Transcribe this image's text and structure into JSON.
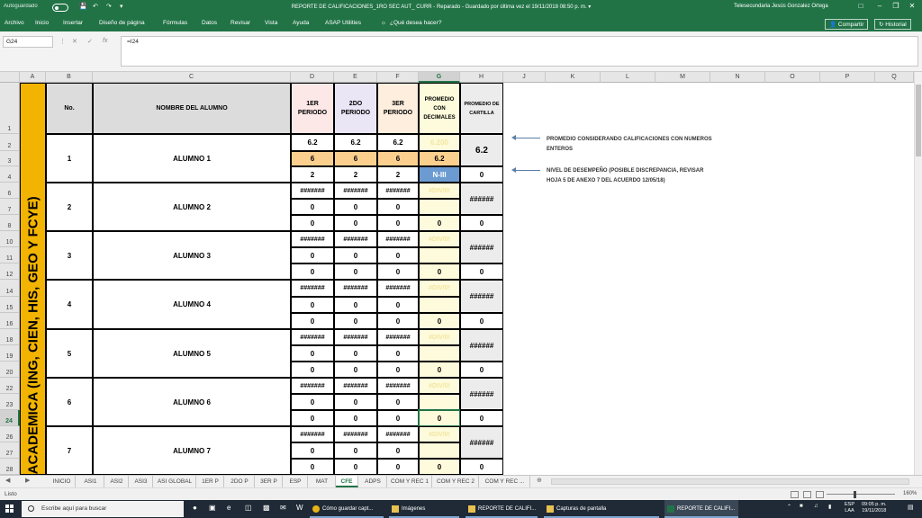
{
  "titlebar": {
    "autosave_label": "Autoguardado",
    "window_title": "REPORTE DE CALIFICACIONES_1RO SEC AUT_ CURR  -  Reparado  -  Guardado por última vez el 19/11/2018 08:50 p. m.  ▾",
    "user_name": "Telesecundaria Jesús Gonzalez Ortega"
  },
  "menu": {
    "items": [
      "Archivo",
      "Inicio",
      "Insertar",
      "Diseño de página",
      "Fórmulas",
      "Datos",
      "Revisar",
      "Vista",
      "Ayuda",
      "ASAP Utilities"
    ],
    "tell_me": "¿Qué desea hacer?",
    "share_label": "Compartir",
    "history_label": "Historial"
  },
  "formula_bar": {
    "name_box": "G24",
    "formula": "=I24"
  },
  "columns": [
    "A",
    "B",
    "C",
    "D",
    "E",
    "F",
    "G",
    "H",
    "J",
    "K",
    "L",
    "M",
    "N",
    "O",
    "P",
    "Q"
  ],
  "row_numbers": [
    "1",
    "2",
    "3",
    "4",
    "6",
    "7",
    "8",
    "10",
    "11",
    "12",
    "14",
    "15",
    "16",
    "18",
    "19",
    "20",
    "22",
    "23",
    "24",
    "26",
    "27",
    "28"
  ],
  "sheet": {
    "banner_text": "ION ACADEMICA (ING, CIEN, HIS, GEO Y FCYE)",
    "headers": {
      "no": "No.",
      "name": "NOMBRE DEL ALUMNO",
      "p1": "1ER PERIODO",
      "p2": "2DO PERIODO",
      "p3": "3ER PERIODO",
      "prom_dec": "PROMEDIO CON DECIMALES",
      "prom_cart": "PROMEDIO DE CARTILLA"
    },
    "students": [
      {
        "no": "1",
        "name": "ALUMNO 1",
        "r1": [
          "6.2",
          "6.2",
          "6.2",
          "6.200"
        ],
        "r2": [
          "6",
          "6",
          "6",
          "6.2"
        ],
        "r3": [
          "2",
          "2",
          "2",
          "N-III"
        ],
        "cart_top": "6.2",
        "cart_bot": "0"
      },
      {
        "no": "2",
        "name": "ALUMNO 2",
        "r1": [
          "#######",
          "#######",
          "#######",
          "#DIV/0!"
        ],
        "r2": [
          "0",
          "0",
          "0",
          ""
        ],
        "r3": [
          "0",
          "0",
          "0",
          "0"
        ],
        "cart_top": "######",
        "cart_bot": "0"
      },
      {
        "no": "3",
        "name": "ALUMNO 3",
        "r1": [
          "#######",
          "#######",
          "#######",
          "#DIV/0!"
        ],
        "r2": [
          "0",
          "0",
          "0",
          ""
        ],
        "r3": [
          "0",
          "0",
          "0",
          "0"
        ],
        "cart_top": "######",
        "cart_bot": "0"
      },
      {
        "no": "4",
        "name": "ALUMNO 4",
        "r1": [
          "#######",
          "#######",
          "#######",
          "#DIV/0!"
        ],
        "r2": [
          "0",
          "0",
          "0",
          ""
        ],
        "r3": [
          "0",
          "0",
          "0",
          "0"
        ],
        "cart_top": "######",
        "cart_bot": "0"
      },
      {
        "no": "5",
        "name": "ALUMNO 5",
        "r1": [
          "#######",
          "#######",
          "#######",
          "#DIV/0!"
        ],
        "r2": [
          "0",
          "0",
          "0",
          ""
        ],
        "r3": [
          "0",
          "0",
          "0",
          "0"
        ],
        "cart_top": "######",
        "cart_bot": "0"
      },
      {
        "no": "6",
        "name": "ALUMNO 6",
        "r1": [
          "#######",
          "#######",
          "#######",
          "#DIV/0!"
        ],
        "r2": [
          "0",
          "0",
          "0",
          ""
        ],
        "r3": [
          "0",
          "0",
          "0",
          "0"
        ],
        "cart_top": "######",
        "cart_bot": "0"
      },
      {
        "no": "7",
        "name": "ALUMNO 7",
        "r1": [
          "#######",
          "#######",
          "#######",
          "#DIV/0!"
        ],
        "r2": [
          "0",
          "0",
          "0",
          ""
        ],
        "r3": [
          "0",
          "0",
          "0",
          "0"
        ],
        "cart_top": "######",
        "cart_bot": "0"
      }
    ],
    "notes": {
      "note1_line1": "PROMEDIO CONSIDERANDO CALIFICACIONES CON NUMEROS",
      "note1_line2": "ENTEROS",
      "note2_line1": "NIVEL DE DESEMPEÑO (POSIBLE DISCREPANCIA, REVISAR",
      "note2_line2": "HOJA 5 DE ANEXO 7 DEL ACUERDO 12/05/18)"
    }
  },
  "tabs": [
    "INICIO",
    "ASI1",
    "ASI2",
    "ASI3",
    "ASI GLOBAL",
    "1ER P",
    "2DO P",
    "3ER P",
    "ESP",
    "MAT",
    "CFE",
    "ADPS",
    "COM Y REC 1",
    "COM Y REC 2",
    "COM Y REC ..."
  ],
  "active_tab": "CFE",
  "status": {
    "ready": "Listo",
    "zoom": "160%"
  },
  "taskbar": {
    "search_placeholder": "Escribe aquí para buscar",
    "apps": [
      "Cómo guardar capt...",
      "Imágenes",
      "REPORTE DE CALIFI...",
      "Capturas de pantalla",
      "REPORTE DE CALIFI..."
    ],
    "lang_line1": "ESP",
    "lang_line2": "LAA",
    "time": "09:05 p. m.",
    "date": "19/11/2018"
  },
  "colors": {
    "excel_green": "#217346",
    "banner_orange": "#f2b400",
    "period1_bg": "#fde8e8",
    "period2_bg": "#eae6f6",
    "period3_bg": "#fdeedd",
    "prom_dec_bg": "#fdfbdb",
    "orange_row": "#fbd08f",
    "level_blue": "#6b9bd1",
    "cartilla_bg": "#ececec"
  }
}
